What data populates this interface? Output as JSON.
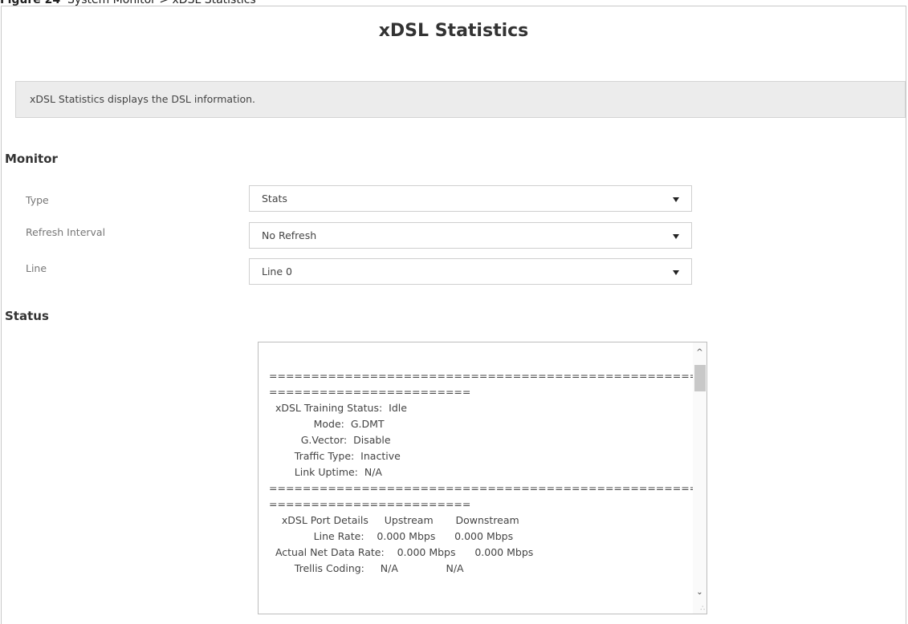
{
  "caption": {
    "figure_label": "Figure 24",
    "figure_text": "System Monitor > xDSL Statistics"
  },
  "page": {
    "title": "xDSL Statistics",
    "description": "xDSL Statistics displays the DSL information."
  },
  "monitor": {
    "title": "Monitor",
    "fields": [
      {
        "label": "Type",
        "value": "Stats"
      },
      {
        "label": "Refresh Interval",
        "value": "No Refresh"
      },
      {
        "label": "Line",
        "value": "Line 0"
      }
    ]
  },
  "status": {
    "title": "Status",
    "lines": [
      "",
      "=====================================================",
      "========================",
      "  xDSL Training Status:  Idle",
      "              Mode:  G.DMT",
      "          G.Vector:  Disable",
      "        Traffic Type:  Inactive",
      "        Link Uptime:  N/A",
      "=====================================================",
      "========================",
      "    xDSL Port Details     Upstream       Downstream",
      "              Line Rate:    0.000 Mbps      0.000 Mbps",
      "  Actual Net Data Rate:    0.000 Mbps      0.000 Mbps",
      "        Trellis Coding:     N/A               N/A"
    ]
  }
}
